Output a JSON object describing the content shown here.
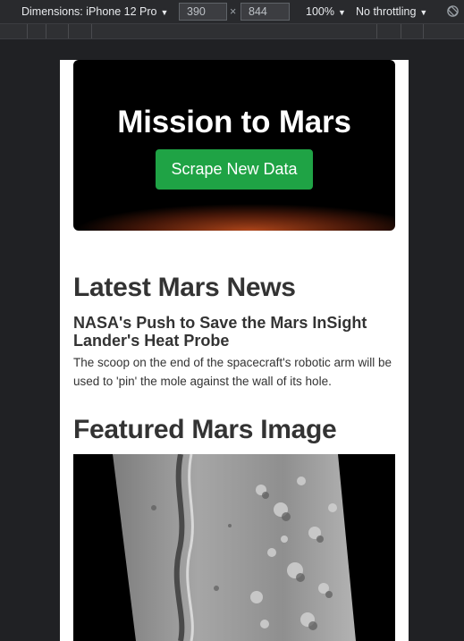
{
  "devtools": {
    "device_label": "Dimensions: iPhone 12 Pro",
    "width": "390",
    "times": "×",
    "height": "844",
    "zoom": "100%",
    "throttling": "No throttling",
    "caret": "▼",
    "rotate_icon": "rotate-icon"
  },
  "page": {
    "hero": {
      "title": "Mission to Mars",
      "button_label": "Scrape New Data",
      "button_color": "#1fa345"
    },
    "news": {
      "heading": "Latest Mars News",
      "title": "NASA's Push to Save the Mars InSight Lander's Heat Probe",
      "paragraph": "The scoop on the end of the spacecraft's robotic arm will be used to 'pin' the mole against the wall of its hole."
    },
    "featured": {
      "heading": "Featured Mars Image"
    }
  }
}
